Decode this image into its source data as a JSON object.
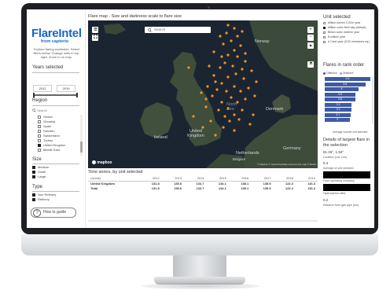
{
  "app": {
    "logo_main": "FlareIntel",
    "logo_sub": "from capterio",
    "intro": "Explore flaring worldwide. Select filters below. Change units in top-right. Zoom in on map."
  },
  "filters": {
    "years_title": "Years selected",
    "year_from": "2012",
    "year_to": "2019",
    "region_title": "Region",
    "search_placeholder": "Search",
    "regions": [
      {
        "label": "Serbia",
        "checked": false
      },
      {
        "label": "Slovakia",
        "checked": false
      },
      {
        "label": "Spain",
        "checked": false
      },
      {
        "label": "Sweden",
        "checked": false
      },
      {
        "label": "Switzerland",
        "checked": false
      },
      {
        "label": "Turkey",
        "checked": false
      },
      {
        "label": "United Kingdom",
        "checked": true
      },
      {
        "label": "Middle East",
        "checked": false
      }
    ],
    "size_title": "Size",
    "sizes": [
      "Medium",
      "Small",
      "Large"
    ],
    "type_title": "Type",
    "types": [
      "Non Refinery",
      "Refinery"
    ],
    "guide_label": "How to guide",
    "guide_glyph": "?"
  },
  "map": {
    "title": "Flare map - Size and darkness scale to flare size",
    "search_placeholder": "Search",
    "zoom_in": "+",
    "zoom_out": "−",
    "compass": "◆",
    "brand": "mapbox",
    "attribution": "© Mapbox © OpenStreetMap Improve this map © Maxar",
    "labels": [
      "Norway",
      "North Sea",
      "Denmark",
      "United Kingdom",
      "Ireland",
      "Netherlands",
      "Belgium",
      "Germany"
    ],
    "flare_color": "#f0932b"
  },
  "units": {
    "title": "Unit selected",
    "options": [
      {
        "label": "Million tonnes CO2e/ year",
        "selected": false
      },
      {
        "label": "Million cubic feet/ day (default)",
        "selected": true
      },
      {
        "label": "Billion cubic meters/ year",
        "selected": false
      },
      {
        "label": "$ million/ year",
        "selected": false
      },
      {
        "label": "# Cars/ year (CO2 emissions eq.)",
        "selected": false
      }
    ]
  },
  "rank": {
    "title": "Flares in rank order",
    "legend": [
      "Offshore",
      "Onshore"
    ],
    "legend_colors": [
      "#3e5aa6",
      "#8aa7e0"
    ],
    "bar_color": "#3e5aa6",
    "values": [
      5.4,
      4.8,
      4.0,
      3.6,
      3.6,
      3.2,
      3.2,
      3.1,
      3.0
    ],
    "axis_note": "Average volume unit selected"
  },
  "details": {
    "title": "Details of largest flare in the selection",
    "coords": "61.26°, 1.53°",
    "coords_label": "Location (Lat, Lon)",
    "volume": "5.4",
    "volume_label": "Average of unit selected",
    "company_label": "Flare operating company",
    "field_label": "Hydrocarbon field",
    "distance": "0.2",
    "distance_label": "Distance from gas pipe (km)"
  },
  "timeseries": {
    "title": "Time series, by unit selected",
    "header": [
      "country",
      "2012",
      "2013",
      "2014",
      "2015",
      "2016",
      "2017",
      "2018",
      "2019"
    ],
    "rows": [
      [
        "United Kingdom",
        "131.8",
        "135.6",
        "134.7",
        "134.1",
        "138.1",
        "135.5",
        "122.2",
        "116.3"
      ],
      [
        "Total",
        "131.8",
        "135.6",
        "134.7",
        "134.1",
        "138.1",
        "135.5",
        "122.2",
        "116.3"
      ]
    ]
  }
}
